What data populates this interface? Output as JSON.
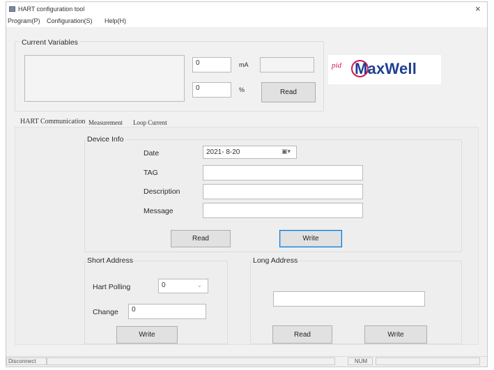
{
  "window": {
    "title": "HART configuration tool",
    "close_glyph": "×"
  },
  "menu": {
    "program": "Program(P)",
    "configuration": "Configuration(S)",
    "help": "Help(H)"
  },
  "current_variables": {
    "title": "Current Variables",
    "ma_value": "0",
    "ma_unit": "mA",
    "pct_value": "0",
    "pct_unit": "%",
    "read_label": "Read"
  },
  "logo": {
    "prefix": "pid",
    "text": "MaxWell",
    "accent_color": "#d2154b",
    "text_color": "#1f3f8f"
  },
  "tabs": [
    {
      "label": "HART Communication",
      "selected": true
    },
    {
      "label": "Measurement",
      "selected": false
    },
    {
      "label": "Loop Current",
      "selected": false
    }
  ],
  "device_info": {
    "title": "Device Info",
    "date_label": "Date",
    "date_value": "2021- 8-20",
    "date_button": "▣▾",
    "tag_label": "TAG",
    "tag_value": "",
    "description_label": "Description",
    "description_value": "",
    "message_label": "Message",
    "message_value": "",
    "read_label": "Read",
    "write_label": "Write"
  },
  "short_address": {
    "title": "Short Address",
    "polling_label": "Hart Polling",
    "polling_value": "0",
    "change_label": "Change",
    "change_value": "0",
    "write_label": "Write"
  },
  "long_address": {
    "title": "Long Address",
    "value": "",
    "read_label": "Read",
    "write_label": "Write"
  },
  "status": {
    "connection": "Disconnect",
    "cell2": "",
    "cell3": "NUM"
  }
}
